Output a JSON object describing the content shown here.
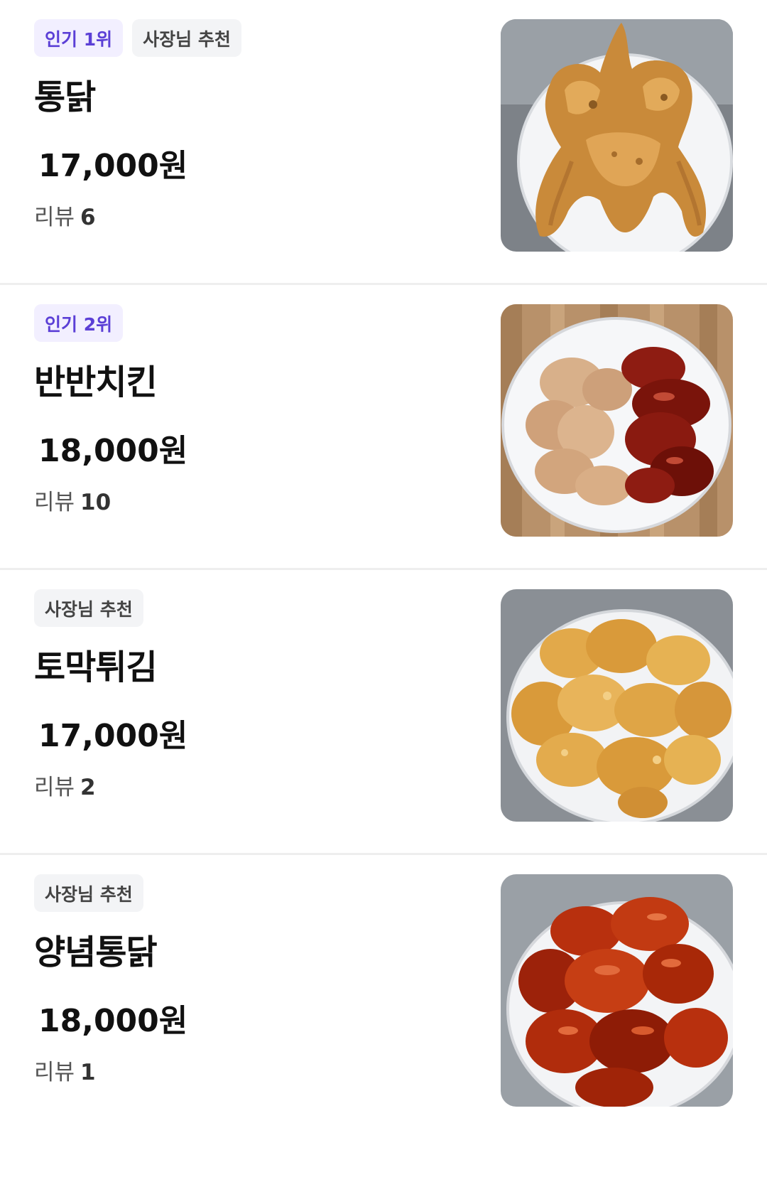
{
  "menu": {
    "items": [
      {
        "badges": [
          {
            "label": "인기 1위",
            "type": "popular"
          },
          {
            "label": "사장님 추천",
            "type": "owner"
          }
        ],
        "name": "통닭",
        "price": "17,000원",
        "review_label": "리뷰",
        "review_count": "6",
        "photo_icon": "whole-fried-chicken-photo"
      },
      {
        "badges": [
          {
            "label": "인기 2위",
            "type": "popular"
          }
        ],
        "name": "반반치킨",
        "price": "18,000원",
        "review_label": "리뷰",
        "review_count": "10",
        "photo_icon": "half-half-chicken-photo"
      },
      {
        "badges": [
          {
            "label": "사장님 추천",
            "type": "owner"
          }
        ],
        "name": "토막튀김",
        "price": "17,000원",
        "review_label": "리뷰",
        "review_count": "2",
        "photo_icon": "fried-chicken-pieces-photo"
      },
      {
        "badges": [
          {
            "label": "사장님 추천",
            "type": "owner"
          }
        ],
        "name": "양념통닭",
        "price": "18,000원",
        "review_label": "리뷰",
        "review_count": "1",
        "photo_icon": "seasoned-chicken-photo"
      }
    ]
  },
  "colors": {
    "popular_badge_bg": "#f2efff",
    "popular_badge_text": "#5b3fd6",
    "owner_badge_bg": "#f3f4f6",
    "owner_badge_text": "#444444",
    "divider": "#eeeeee"
  }
}
